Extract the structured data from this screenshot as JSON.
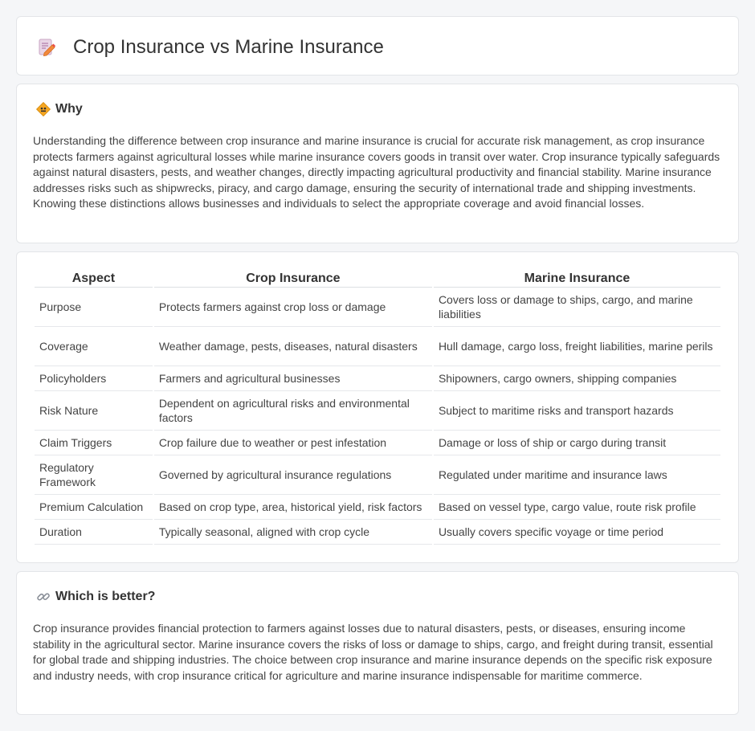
{
  "header": {
    "title": "Crop Insurance vs Marine Insurance",
    "icon": "pencil-document-icon"
  },
  "why": {
    "heading": "Why",
    "icon": "warning-sign-icon",
    "text": "Understanding the difference between crop insurance and marine insurance is crucial for accurate risk management, as crop insurance protects farmers against agricultural losses while marine insurance covers goods in transit over water. Crop insurance typically safeguards against natural disasters, pests, and weather changes, directly impacting agricultural productivity and financial stability. Marine insurance addresses risks such as shipwrecks, piracy, and cargo damage, ensuring the security of international trade and shipping investments. Knowing these distinctions allows businesses and individuals to select the appropriate coverage and avoid financial losses."
  },
  "table": {
    "headers": [
      "Aspect",
      "Crop Insurance",
      "Marine Insurance"
    ],
    "rows": [
      [
        "Purpose",
        "Protects farmers against crop loss or damage",
        "Covers loss or damage to ships, cargo, and marine liabilities"
      ],
      [
        "Coverage",
        "Weather damage, pests, diseases, natural disasters",
        "Hull damage, cargo loss, freight liabilities, marine perils"
      ],
      [
        "Policyholders",
        "Farmers and agricultural businesses",
        "Shipowners, cargo owners, shipping companies"
      ],
      [
        "Risk Nature",
        "Dependent on agricultural risks and environmental factors",
        "Subject to maritime risks and transport hazards"
      ],
      [
        "Claim Triggers",
        "Crop failure due to weather or pest infestation",
        "Damage or loss of ship or cargo during transit"
      ],
      [
        "Regulatory Framework",
        "Governed by agricultural insurance regulations",
        "Regulated under maritime and insurance laws"
      ],
      [
        "Premium Calculation",
        "Based on crop type, area, historical yield, risk factors",
        "Based on vessel type, cargo value, route risk profile"
      ],
      [
        "Duration",
        "Typically seasonal, aligned with crop cycle",
        "Usually covers specific voyage or time period"
      ]
    ]
  },
  "better": {
    "heading": "Which is better?",
    "icon": "link-icon",
    "text": "Crop insurance provides financial protection to farmers against losses due to natural disasters, pests, or diseases, ensuring income stability in the agricultural sector. Marine insurance covers the risks of loss or damage to ships, cargo, and freight during transit, essential for global trade and shipping industries. The choice between crop insurance and marine insurance depends on the specific risk exposure and industry needs, with crop insurance critical for agriculture and marine insurance indispensable for maritime commerce."
  }
}
